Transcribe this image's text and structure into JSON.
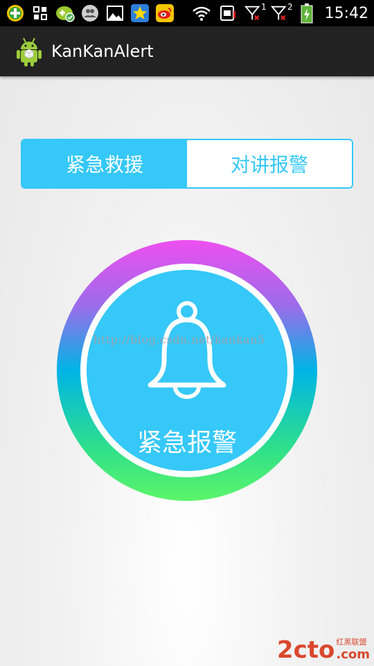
{
  "status_bar": {
    "time": "15:42",
    "icons": [
      "green-plus-icon",
      "grid-icon",
      "gamepad-icon",
      "people-icon",
      "image-icon",
      "star-icon",
      "weibo-icon",
      "wifi-icon",
      "sim-icon",
      "signal-1-icon",
      "signal-2-icon",
      "battery-charging-icon"
    ],
    "signal_1_label": "1",
    "signal_2_label": "2"
  },
  "action_bar": {
    "app_icon": "android-icon",
    "title": "KanKanAlert"
  },
  "tabs": [
    {
      "label": "紧急救援",
      "selected": true
    },
    {
      "label": "对讲报警",
      "selected": false
    }
  ],
  "alarm": {
    "icon": "bell-icon",
    "label": "紧急报警",
    "colors": {
      "top": "#ee4ff0",
      "middle": "#00b4e6",
      "bottom": "#5cf56a",
      "inner": "#35c8f8"
    }
  },
  "watermark": "http://blog.csdn.net/kankan5",
  "logo": {
    "main": "2cto",
    "small": "红黑联盟",
    "suffix": ".com"
  }
}
